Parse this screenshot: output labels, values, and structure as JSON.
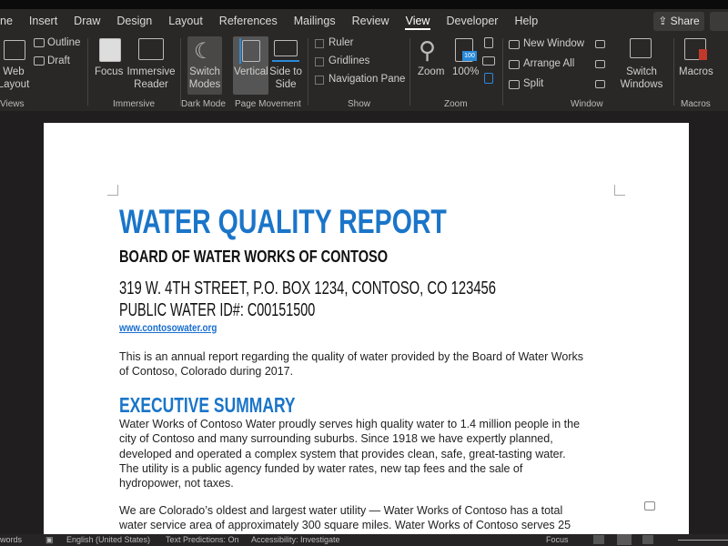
{
  "tabs": [
    "ne",
    "Insert",
    "Draw",
    "Design",
    "Layout",
    "References",
    "Mailings",
    "Review",
    "View",
    "Developer",
    "Help"
  ],
  "active_tab": "View",
  "share_label": "Share",
  "ribbon": {
    "views": {
      "web_layout": "Web Layout",
      "outline": "Outline",
      "draft": "Draft",
      "group": "Views"
    },
    "immersive": {
      "focus": "Focus",
      "immersive_reader": "Immersive Reader",
      "group": "Immersive"
    },
    "dark_mode": {
      "switch_modes": "Switch Modes",
      "group": "Dark Mode"
    },
    "page_movement": {
      "vertical": "Vertical",
      "side_to_side": "Side to Side",
      "group": "Page Movement"
    },
    "show": {
      "ruler": "Ruler",
      "gridlines": "Gridlines",
      "navigation_pane": "Navigation Pane",
      "group": "Show"
    },
    "zoom": {
      "zoom": "Zoom",
      "hundred": "100%",
      "badge": "100",
      "group": "Zoom"
    },
    "window": {
      "new_window": "New Window",
      "arrange_all": "Arrange All",
      "split": "Split",
      "switch_windows": "Switch Windows",
      "group": "Window"
    },
    "macros": {
      "macros": "Macros",
      "group": "Macros"
    }
  },
  "document": {
    "title": "WATER QUALITY REPORT",
    "subtitle": "BOARD OF WATER WORKS OF CONTOSO",
    "address": "319 W. 4TH STREET, P.O. BOX 1234, CONTOSO, CO 123456",
    "water_id": "PUBLIC WATER ID#: C00151500",
    "website": "www.contosowater.org",
    "intro": [
      "This is an annual report regarding the quality of water provided by the Board of Water Works",
      "of Contoso, Colorado during 2017."
    ],
    "exec_heading": "EXECUTIVE SUMMARY",
    "exec_p1": [
      "Water Works of Contoso Water proudly serves high quality water to 1.4 million people in the",
      "city of Contoso and many surrounding suburbs. Since 1918 we have expertly planned,",
      "developed and operated a complex system that provides clean, safe, great-tasting water.",
      "The utility is a public agency funded by water rates, new tap fees and the sale of",
      "hydropower, not taxes."
    ],
    "exec_p2": [
      "We are Colorado’s oldest and largest water utility — Water Works of Contoso has a total",
      "water service area of approximately 300 square miles. Water Works of Contoso serves 25"
    ]
  },
  "status": {
    "words": "words",
    "language": "English (United States)",
    "predictions": "Text Predictions: On",
    "accessibility": "Accessibility: Investigate",
    "focus": "Focus"
  },
  "colors": {
    "accent": "#1a75c9",
    "link": "#1a6fd0"
  }
}
